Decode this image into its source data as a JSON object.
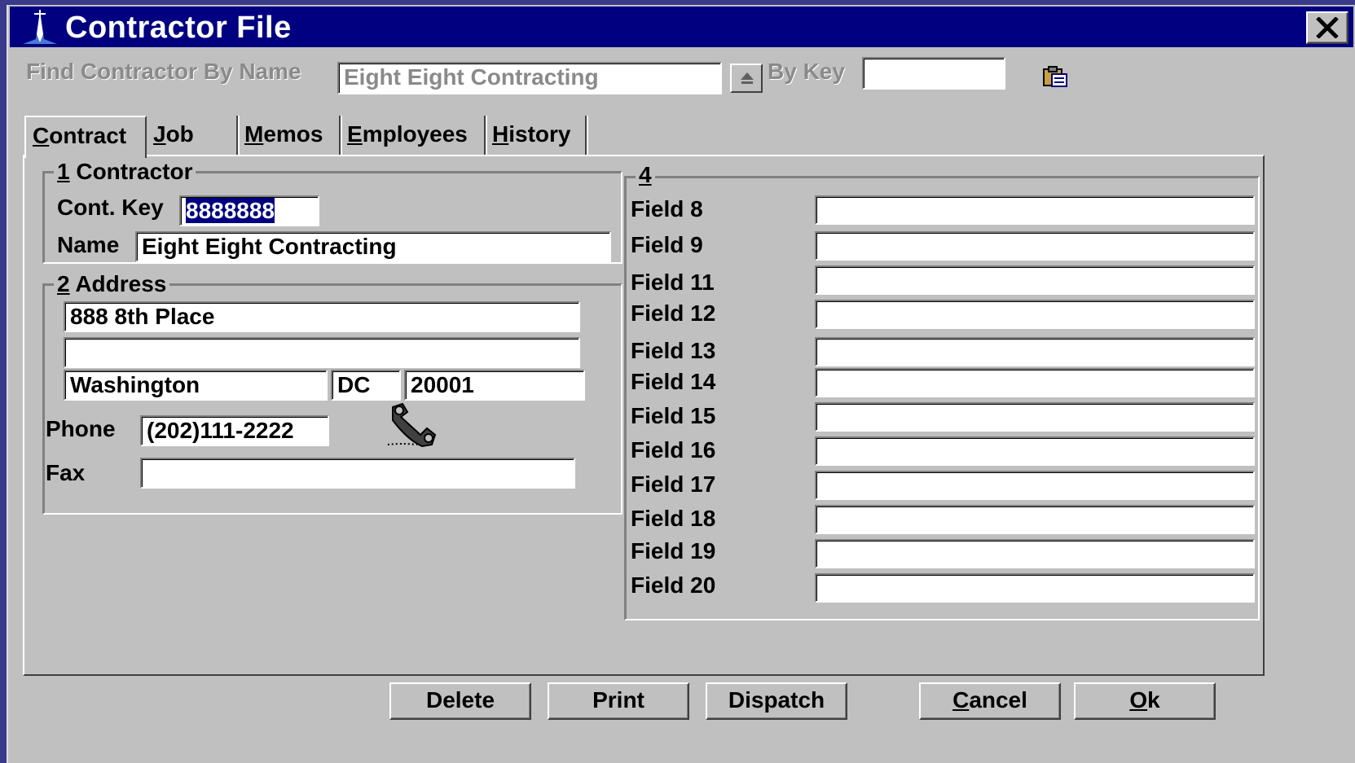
{
  "window": {
    "title": "Contractor File"
  },
  "find": {
    "label": "Find Contractor By Name",
    "name_value": "Eight Eight Contracting",
    "bykey_label": "By Key",
    "bykey_value": ""
  },
  "tabs": [
    {
      "prefix": "",
      "accel": "C",
      "rest": "ontract"
    },
    {
      "prefix": "",
      "accel": "J",
      "rest": "ob"
    },
    {
      "prefix": "",
      "accel": "M",
      "rest": "emos"
    },
    {
      "prefix": "",
      "accel": "E",
      "rest": "mployees"
    },
    {
      "prefix": "",
      "accel": "H",
      "rest": "istory"
    }
  ],
  "contractor": {
    "num": "1",
    "title": " Contractor",
    "key_label": "Cont. Key",
    "key_value": "8888888",
    "name_label": "Name",
    "name_value": "Eight Eight Contracting"
  },
  "address": {
    "num": "2",
    "title": " Address",
    "line1": "888 8th Place",
    "line2": "",
    "city": "Washington",
    "state": "DC",
    "zip": "20001",
    "phone_label": "Phone",
    "phone_value": "(202)111-2222",
    "fax_label": "Fax",
    "fax_value": ""
  },
  "group4": {
    "num": "4",
    "fields": [
      {
        "label": "Field 8",
        "value": ""
      },
      {
        "label": "Field 9",
        "value": ""
      },
      {
        "label": "Field 11",
        "value": ""
      },
      {
        "label": "Field 12",
        "value": ""
      },
      {
        "label": "Field 13",
        "value": ""
      },
      {
        "label": "Field 14",
        "value": ""
      },
      {
        "label": "Field 15",
        "value": ""
      },
      {
        "label": "Field 16",
        "value": ""
      },
      {
        "label": "Field 17",
        "value": ""
      },
      {
        "label": "Field 18",
        "value": ""
      },
      {
        "label": "Field 19",
        "value": ""
      },
      {
        "label": "Field 20",
        "value": ""
      }
    ]
  },
  "buttons": {
    "delete": "Delete",
    "print": "Print",
    "dispatch": "Dispatch",
    "cancel_accel": "C",
    "cancel_rest": "ancel",
    "ok_accel": "O",
    "ok_rest": "k"
  },
  "icons": {
    "app": "star-icon",
    "close": "close-icon",
    "dropdown": "scroll-up-icon",
    "lookup": "clipboard-icon",
    "dialer": "phone-handset-icon"
  },
  "colors": {
    "titlebar": "#000080",
    "face": "#c0c0c0",
    "selection": "#000080"
  }
}
